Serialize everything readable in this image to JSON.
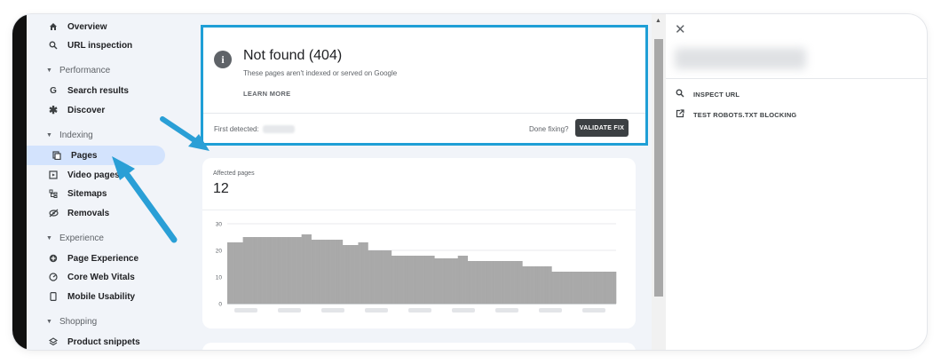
{
  "sidebar": {
    "items_top": [
      {
        "label": "Overview",
        "icon": "home-icon"
      },
      {
        "label": "URL inspection",
        "icon": "search-icon"
      }
    ],
    "sections": [
      {
        "title": "Performance",
        "items": [
          {
            "label": "Search results",
            "icon": "google-g-icon"
          },
          {
            "label": "Discover",
            "icon": "asterisk-icon"
          }
        ]
      },
      {
        "title": "Indexing",
        "items": [
          {
            "label": "Pages",
            "icon": "pages-icon",
            "active": true
          },
          {
            "label": "Video pages",
            "icon": "video-pages-icon"
          },
          {
            "label": "Sitemaps",
            "icon": "sitemaps-icon"
          },
          {
            "label": "Removals",
            "icon": "removals-icon"
          }
        ]
      },
      {
        "title": "Experience",
        "items": [
          {
            "label": "Page Experience",
            "icon": "page-experience-icon"
          },
          {
            "label": "Core Web Vitals",
            "icon": "gauge-icon"
          },
          {
            "label": "Mobile Usability",
            "icon": "phone-icon"
          }
        ]
      },
      {
        "title": "Shopping",
        "items": [
          {
            "label": "Product snippets",
            "icon": "layers-icon"
          }
        ]
      }
    ]
  },
  "issue": {
    "title": "Not found (404)",
    "subtitle": "These pages aren't indexed or served on Google",
    "learn_more": "LEARN MORE",
    "first_detected_label": "First detected:",
    "done_fixing": "Done fixing?",
    "validate_label": "VALIDATE FIX"
  },
  "affected": {
    "label": "Affected pages",
    "value": "12"
  },
  "chart_data": {
    "type": "bar",
    "ylim": [
      0,
      30
    ],
    "yticks": [
      "30",
      "20",
      "10",
      "0"
    ],
    "values": [
      23,
      23,
      23,
      23,
      23,
      23,
      23,
      23,
      25,
      25,
      25,
      25,
      25,
      25,
      25,
      25,
      25,
      25,
      25,
      25,
      25,
      25,
      25,
      25,
      25,
      25,
      25,
      25,
      25,
      25,
      25,
      25,
      25,
      25,
      25,
      25,
      25,
      25,
      26,
      26,
      26,
      26,
      26,
      24,
      24,
      24,
      24,
      24,
      24,
      24,
      24,
      24,
      24,
      24,
      24,
      24,
      24,
      24,
      24,
      22,
      22,
      22,
      22,
      22,
      22,
      22,
      22,
      23,
      23,
      23,
      23,
      23,
      20,
      20,
      20,
      20,
      20,
      20,
      20,
      20,
      20,
      20,
      20,
      20,
      18,
      18,
      18,
      18,
      18,
      18,
      18,
      18,
      18,
      18,
      18,
      18,
      18,
      18,
      18,
      18,
      18,
      18,
      18,
      18,
      18,
      18,
      17,
      17,
      17,
      17,
      17,
      17,
      17,
      17,
      17,
      17,
      17,
      17,
      18,
      18,
      18,
      18,
      18,
      16,
      16,
      16,
      16,
      16,
      16,
      16,
      16,
      16,
      16,
      16,
      16,
      16,
      16,
      16,
      16,
      16,
      16,
      16,
      16,
      16,
      16,
      16,
      16,
      16,
      16,
      16,
      16,
      14,
      14,
      14,
      14,
      14,
      14,
      14,
      14,
      14,
      14,
      14,
      14,
      14,
      14,
      14,
      12,
      12,
      12,
      12,
      12,
      12,
      12,
      12,
      12,
      12,
      12,
      12,
      12,
      12,
      12,
      12,
      12,
      12,
      12,
      12,
      12,
      12,
      12,
      12,
      12,
      12,
      12,
      12,
      12,
      12,
      12,
      12,
      12
    ],
    "bar_color": "#a9a9a9",
    "grid": true
  },
  "panel": {
    "actions": [
      {
        "label": "INSPECT URL",
        "icon": "search-icon"
      },
      {
        "label": "TEST ROBOTS.TXT BLOCKING",
        "icon": "open-external-icon"
      }
    ]
  },
  "colors": {
    "highlight": "#1f9fd6",
    "arrow": "#2a9fd6",
    "active_nav": "#d3e3fd"
  }
}
